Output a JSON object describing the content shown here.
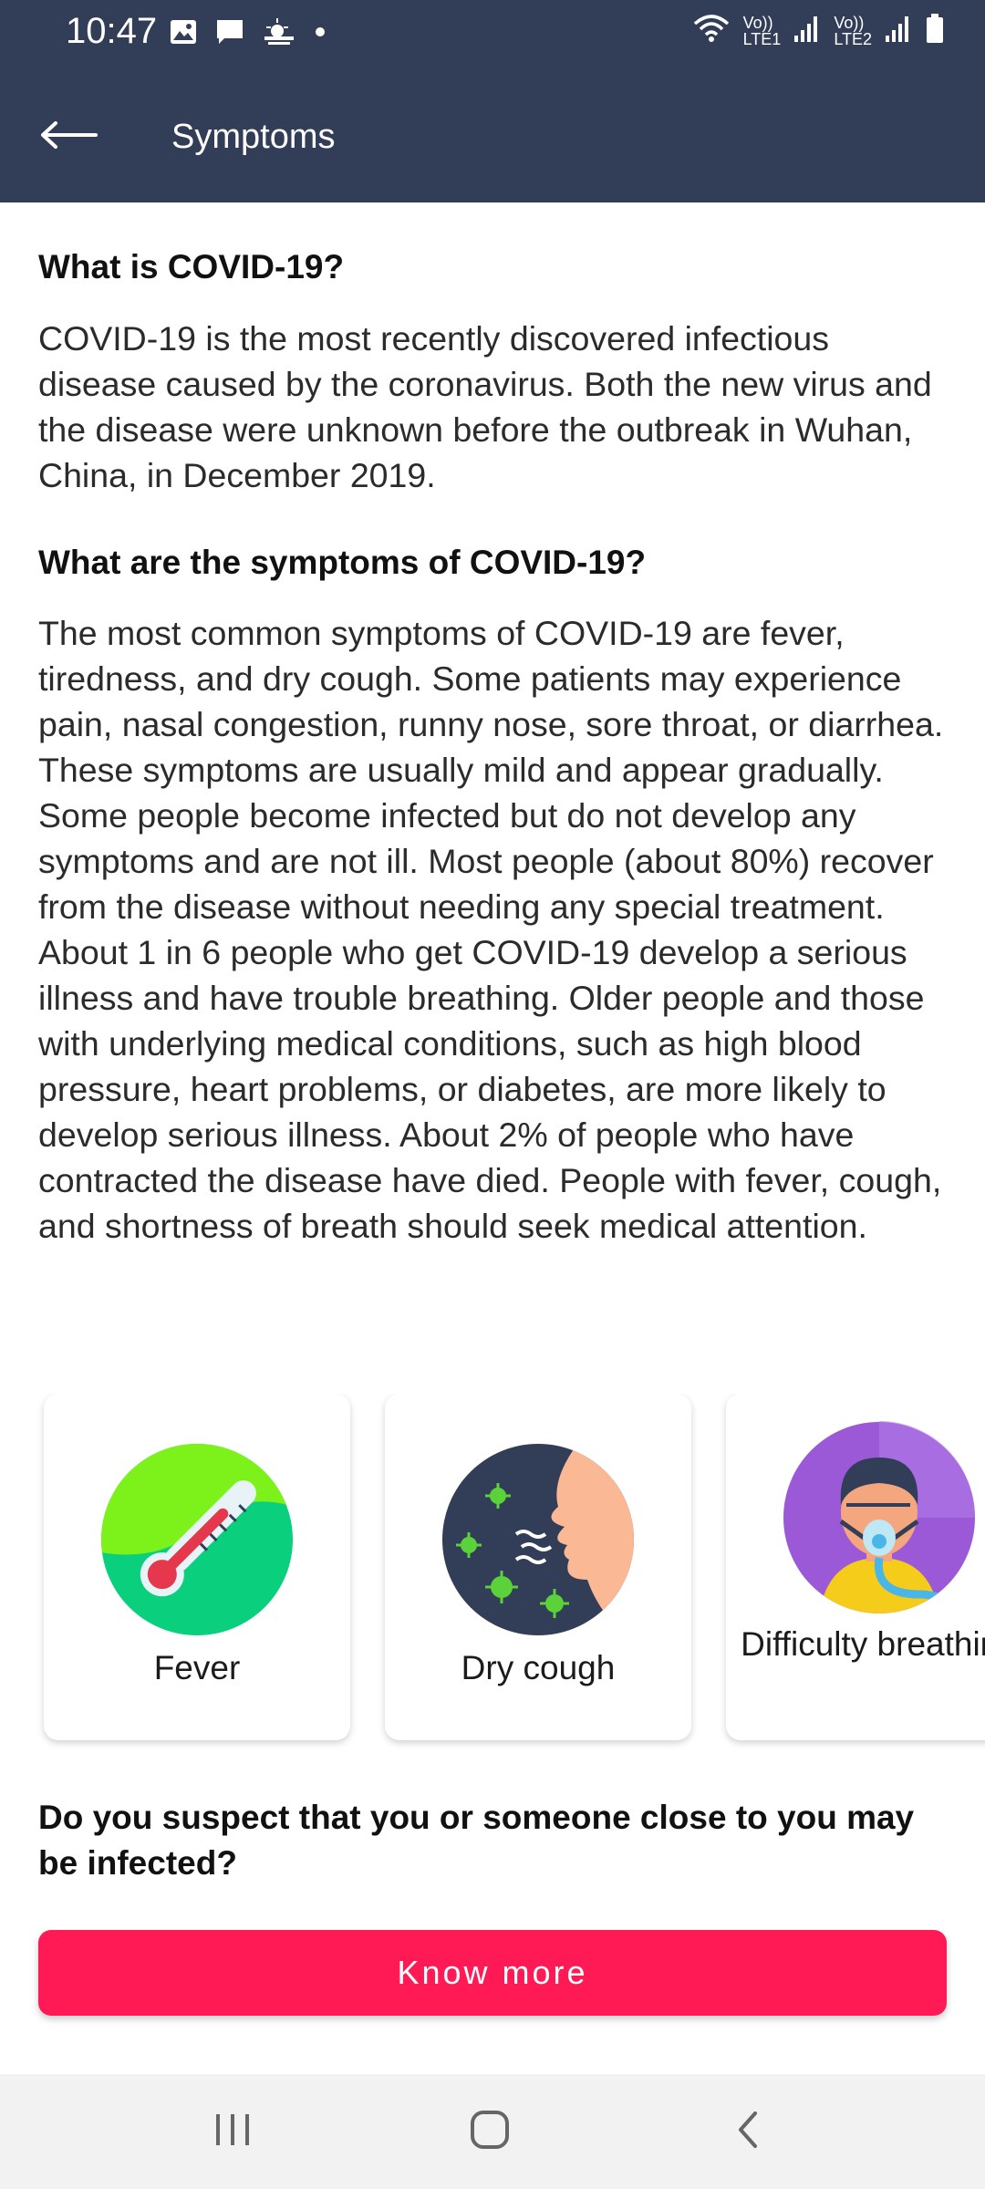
{
  "status_bar": {
    "time": "10:47",
    "sim1_label": "Vo))\nLTE1",
    "sim2_label": "Vo))\nLTE2",
    "icons": [
      "image-icon",
      "message-icon",
      "weather-icon",
      "dot-icon",
      "wifi-icon",
      "signal-icon",
      "battery-icon"
    ]
  },
  "app_bar": {
    "title": "Symptoms",
    "back_icon": "arrow-left-icon",
    "color": "#323d58"
  },
  "sections": [
    {
      "heading": "What is COVID-19?",
      "body": "COVID-19 is the most recently discovered infectious disease caused by the coronavirus. Both the new virus and the disease were unknown before the outbreak in Wuhan, China, in December 2019."
    },
    {
      "heading": "What are the symptoms of COVID-19?",
      "body": "The most common symptoms of COVID-19 are fever, tiredness, and dry cough. Some patients may experience pain, nasal congestion, runny nose, sore throat, or diarrhea. These symptoms are usually mild and appear gradually. Some people become infected but do not develop any symptoms and are not ill. Most people (about 80%) recover from the disease without needing any special treatment. About 1 in 6 people who get COVID-19 develop a serious illness and have trouble breathing. Older people and those with underlying medical conditions, such as high blood pressure, heart problems, or diabetes, are more likely to develop serious illness. About 2% of people who have contracted the disease have died. People with fever, cough, and shortness of breath should seek medical attention."
    }
  ],
  "symptom_cards": [
    {
      "label": "Fever",
      "icon": "thermometer-icon"
    },
    {
      "label": "Dry cough",
      "icon": "cough-icon"
    },
    {
      "label": "Difficulty breathing",
      "icon": "oxygen-mask-icon"
    }
  ],
  "question": "Do you suspect that you or someone close to you may be infected?",
  "cta": {
    "label": "Know more",
    "color": "#ff1a55"
  },
  "nav_bar": {
    "icons": [
      "recent-apps-icon",
      "home-icon",
      "back-icon"
    ]
  }
}
